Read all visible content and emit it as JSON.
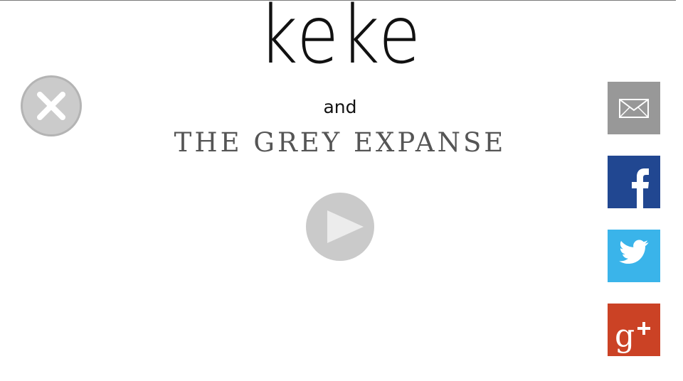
{
  "title": {
    "main": "keke",
    "connector": "and",
    "subtitle": "THE GREY EXPANSE"
  },
  "controls": {
    "close_icon": "close-icon",
    "play_icon": "play-icon"
  },
  "share_buttons": [
    {
      "name": "email",
      "icon": "envelope-icon",
      "color": "#989898"
    },
    {
      "name": "facebook",
      "icon": "facebook-icon",
      "color": "#214791"
    },
    {
      "name": "twitter",
      "icon": "twitter-bird-icon",
      "color": "#3ab4ea"
    },
    {
      "name": "google-plus",
      "icon": "google-plus-icon",
      "color": "#cb4225"
    }
  ],
  "colors": {
    "background": "#ffffff",
    "title": "#111111",
    "subtitle": "#555555",
    "button_grey": "#cbcbcb"
  }
}
